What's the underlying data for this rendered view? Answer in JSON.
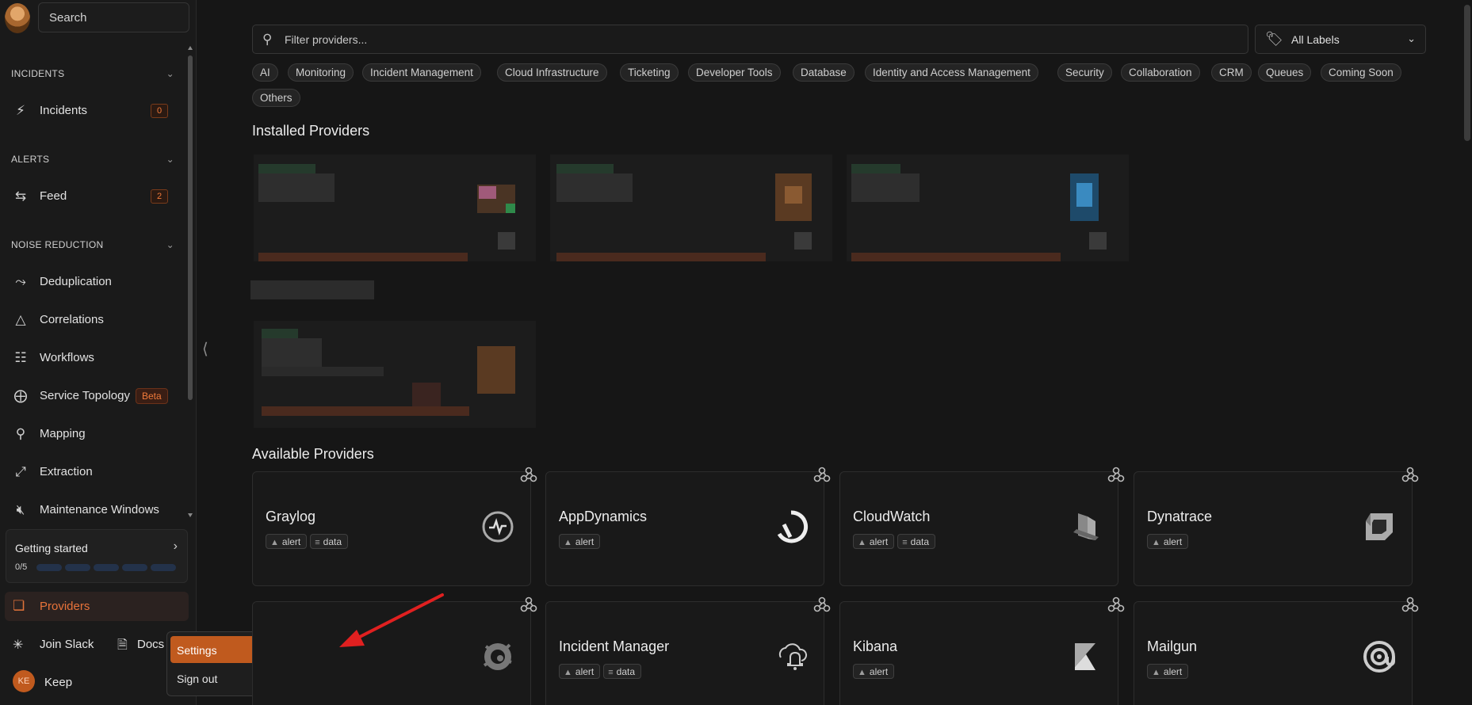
{
  "sidebar": {
    "search_label": "Search",
    "sections": {
      "incidents": "INCIDENTS",
      "alerts": "ALERTS",
      "noise_reduction": "NOISE REDUCTION"
    },
    "items": {
      "incidents": {
        "label": "Incidents",
        "count": "0"
      },
      "feed": {
        "label": "Feed",
        "count": "2"
      },
      "deduplication": {
        "label": "Deduplication"
      },
      "correlations": {
        "label": "Correlations"
      },
      "workflows": {
        "label": "Workflows"
      },
      "service_topology": {
        "label": "Service Topology",
        "badge": "Beta"
      },
      "mapping": {
        "label": "Mapping"
      },
      "extraction": {
        "label": "Extraction"
      },
      "maintenance": {
        "label": "Maintenance Windows"
      }
    },
    "getting_started": {
      "title": "Getting started",
      "progress": "0/5",
      "steps_total": 5,
      "steps_done": 0
    },
    "providers": {
      "label": "Providers"
    },
    "join_slack": {
      "label": "Join Slack"
    },
    "docs": {
      "label": "Docs"
    },
    "user": {
      "initials": "KE",
      "name": "Keep"
    }
  },
  "menu": {
    "settings": "Settings",
    "sign_out": "Sign out"
  },
  "main": {
    "filter_placeholder": "Filter providers...",
    "labels_select": "All Labels",
    "chips": [
      "AI",
      "Monitoring",
      "Incident Management",
      "Cloud Infrastructure",
      "Ticketing",
      "Developer Tools",
      "Database",
      "Identity and Access Management",
      "Security",
      "Collaboration",
      "CRM",
      "Queues",
      "Coming Soon",
      "Others"
    ],
    "installed_title": "Installed Providers",
    "available_title": "Available Providers",
    "providers": [
      {
        "name": "Graylog",
        "tags": [
          "alert",
          "data"
        ],
        "logo": "graylog-logo-icon"
      },
      {
        "name": "AppDynamics",
        "tags": [
          "alert"
        ],
        "logo": "appdynamics-logo-icon"
      },
      {
        "name": "CloudWatch",
        "tags": [
          "alert",
          "data"
        ],
        "logo": "cloudwatch-logo-icon"
      },
      {
        "name": "Dynatrace",
        "tags": [
          "alert"
        ],
        "logo": "dynatrace-logo-icon"
      },
      {
        "name": "",
        "tags": [],
        "logo": "grafana-logo-icon"
      },
      {
        "name": "Incident Manager",
        "tags": [
          "alert",
          "data"
        ],
        "logo": "incident-manager-logo-icon"
      },
      {
        "name": "Kibana",
        "tags": [
          "alert"
        ],
        "logo": "kibana-logo-icon"
      },
      {
        "name": "Mailgun",
        "tags": [
          "alert"
        ],
        "logo": "mailgun-logo-icon"
      }
    ]
  },
  "colors": {
    "accent": "#e0733a",
    "settings_bg": "#c05a1e",
    "annotation_arrow": "#e02020"
  }
}
